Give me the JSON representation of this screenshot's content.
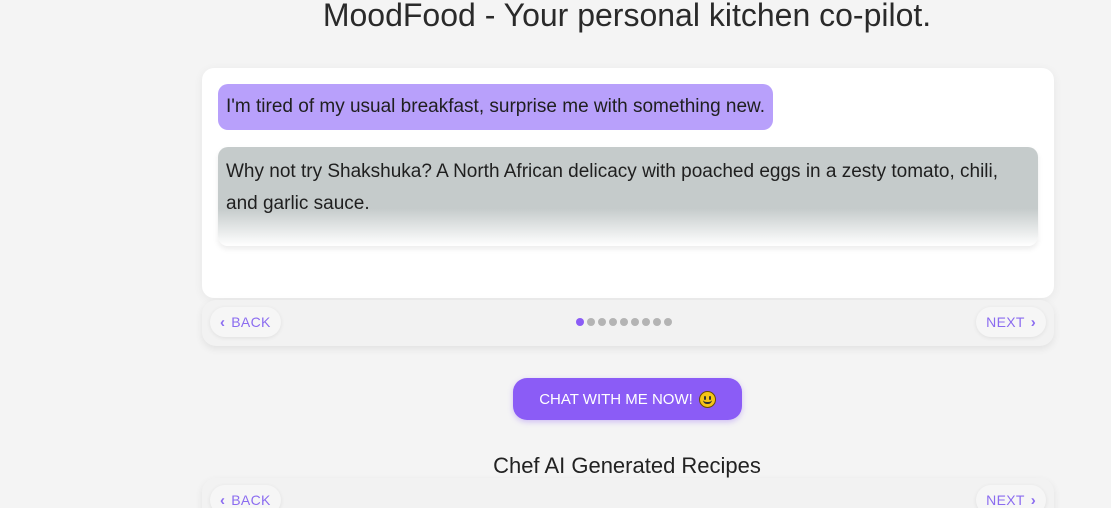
{
  "header": {
    "title": "MoodFood - Your personal kitchen co-pilot."
  },
  "chat": {
    "user_message": "I'm tired of my usual breakfast, surprise me with something new.",
    "bot_message": "Why not try Shakshuka? A North African delicacy with poached eggs in a zesty tomato, chili, and garlic sauce."
  },
  "carousel": {
    "back_label": "BACK",
    "next_label": "NEXT",
    "page_count": 9,
    "active_index": 0
  },
  "cta": {
    "label": "CHAT WITH ME NOW!",
    "icon": "smiley-face-icon"
  },
  "recipes": {
    "title": "Chef AI Generated Recipes",
    "back_label": "BACK",
    "next_label": "NEXT"
  },
  "colors": {
    "accent": "#8b5cf6",
    "user_bubble": "#b8a0fb",
    "bot_bubble": "#c5cbcb"
  }
}
